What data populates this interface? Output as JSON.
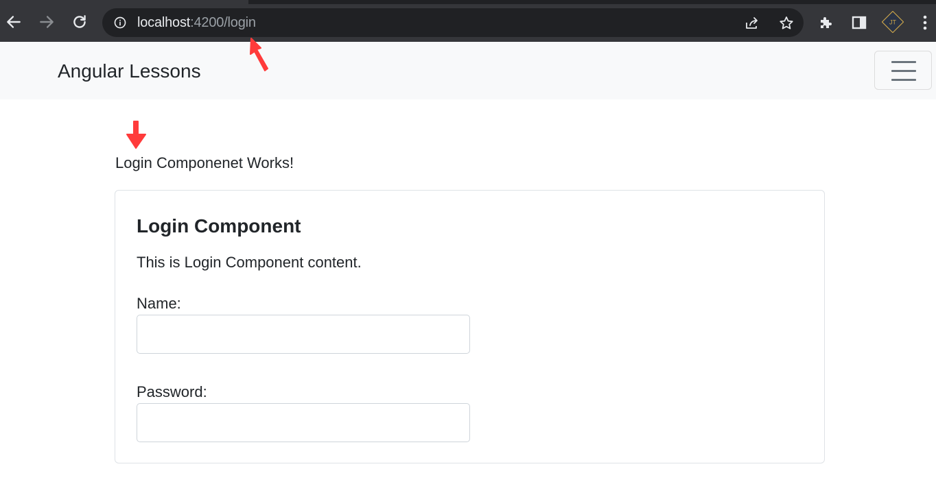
{
  "browser": {
    "url_host": "localhost",
    "url_rest": ":4200/login",
    "avatar_initials": "JT",
    "icons": {
      "back": "arrow-left-icon",
      "forward": "arrow-right-icon",
      "reload": "reload-icon",
      "site_info": "info-icon",
      "share": "share-icon",
      "bookmark": "star-icon",
      "extensions": "puzzle-icon",
      "side_panel": "side-panel-icon",
      "menu": "kebab-menu-icon"
    }
  },
  "navbar": {
    "brand": "Angular Lessons",
    "toggler_icon": "hamburger-menu-icon"
  },
  "page": {
    "works_text": "Login Componenet Works!"
  },
  "card": {
    "title": "Login Component",
    "text": "This is Login Component content.",
    "name_label": "Name:",
    "password_label": "Password:",
    "name_value": "",
    "password_value": ""
  },
  "colors": {
    "chrome": "#35363a",
    "omnibox": "#202124",
    "navbar_bg": "#f8f9fa",
    "annotation_red": "#ff3b3b"
  }
}
